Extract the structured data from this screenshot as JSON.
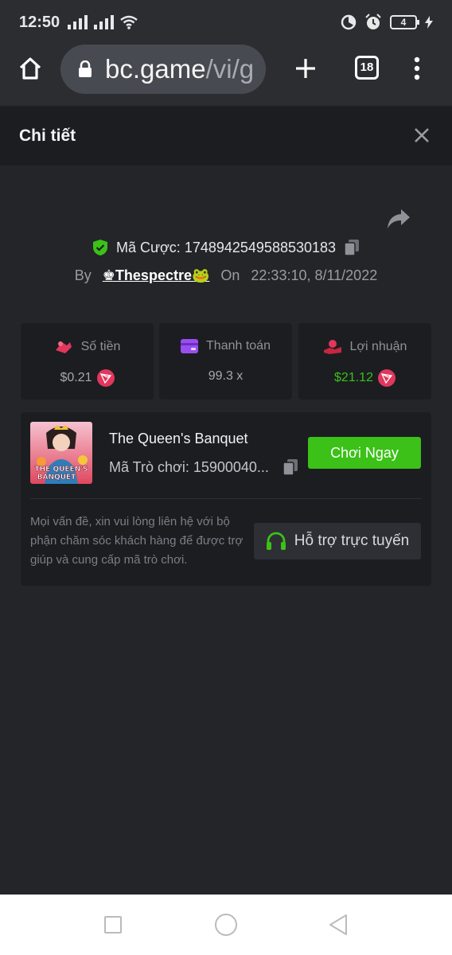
{
  "status_bar": {
    "time": "12:50",
    "battery": "4"
  },
  "browser": {
    "url_host": "bc.game",
    "url_path": "/vi/g",
    "tab_count": "18"
  },
  "details": {
    "title": "Chi tiết"
  },
  "bet": {
    "id_label": "Mã Cược:",
    "id_value": "1748942549588530183",
    "by_label": "By",
    "username": "♚Thespectre🐸",
    "on_label": "On",
    "datetime": "22:33:10, 8/11/2022"
  },
  "stats": {
    "amount": {
      "label": "Số tiền",
      "value": "$0.21"
    },
    "payout": {
      "label": "Thanh toán",
      "value": "99.3 x"
    },
    "profit": {
      "label": "Lợi nhuận",
      "value": "$21.12"
    }
  },
  "game": {
    "name": "The Queen's Banquet",
    "code_label": "Mã Trò chơi:",
    "code_value": "15900040...",
    "play_label": "Chơi Ngay",
    "thumb_line1": "THE QUEEN'S",
    "thumb_line2": "BANQUET",
    "support_text": "Mọi vấn đề, xin vui lòng liên hệ với bộ phận chăm sóc khách hàng để được trợ giúp và cung cấp mã trò chơi.",
    "support_label": "Hỗ trợ trực tuyến"
  },
  "colors": {
    "accent_green": "#3bc117",
    "panel": "#1b1d21",
    "background": "#232528",
    "trx_red": "#e2365c"
  }
}
